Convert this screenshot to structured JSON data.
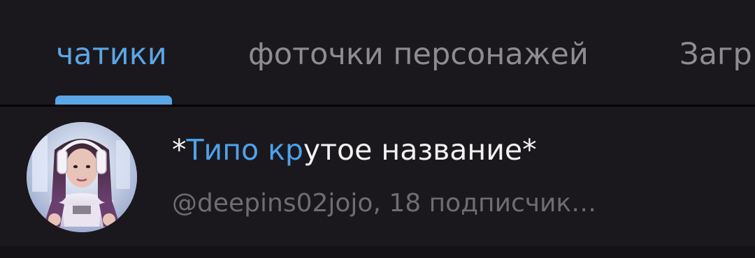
{
  "tabs": [
    {
      "label": "чатики",
      "active": true
    },
    {
      "label": "фоточки персонажей",
      "active": false
    },
    {
      "label": "Загр",
      "active": false
    }
  ],
  "channel": {
    "title_prefix": "*",
    "title_highlight": "Типо кр",
    "title_rest": "утое название*",
    "subtitle": "@deepins02jojo, 18 подписчик…"
  },
  "colors": {
    "accent": "#5aa6e6",
    "background": "#1a181c",
    "text_primary": "#f2f2f2",
    "text_secondary": "#6f6c72",
    "tab_inactive": "#8f8c91"
  },
  "icons": {
    "avatar": "profile-photo-avatar"
  }
}
